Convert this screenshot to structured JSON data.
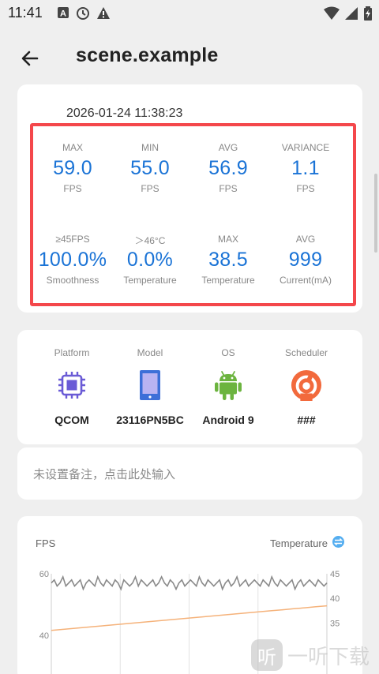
{
  "status_bar": {
    "time": "11:41",
    "left_icons": [
      "text-a-icon",
      "clock-icon",
      "warning-icon"
    ],
    "right_icons": [
      "wifi-icon",
      "cellular-icon",
      "battery-charging-icon"
    ]
  },
  "app_bar": {
    "title": "scene.example"
  },
  "summary": {
    "timestamp": "2026-01-24 11:38:23",
    "stats_row1": [
      {
        "label": "MAX",
        "value": "59.0",
        "unit": "FPS"
      },
      {
        "label": "MIN",
        "value": "55.0",
        "unit": "FPS"
      },
      {
        "label": "AVG",
        "value": "56.9",
        "unit": "FPS"
      },
      {
        "label": "VARIANCE",
        "value": "1.1",
        "unit": "FPS"
      }
    ],
    "stats_row2": [
      {
        "label": "≥45FPS",
        "value": "100.0%",
        "unit": "Smoothness"
      },
      {
        "label": "＞46°C",
        "value": "0.0%",
        "unit": "Temperature"
      },
      {
        "label": "MAX",
        "value": "38.5",
        "unit": "Temperature"
      },
      {
        "label": "AVG",
        "value": "999",
        "unit": "Current(mA)"
      }
    ],
    "highlight_color": "#f4474b",
    "value_color": "#1a73d6"
  },
  "device": {
    "items": [
      {
        "label": "Platform",
        "value": "QCOM",
        "icon": "chip-icon"
      },
      {
        "label": "Model",
        "value": "23116PN5BC",
        "icon": "phone-icon"
      },
      {
        "label": "OS",
        "value": "Android 9",
        "icon": "android-icon"
      },
      {
        "label": "Scheduler",
        "value": "###",
        "icon": "scheduler-icon"
      }
    ]
  },
  "note": {
    "placeholder": "未设置备注，点击此处输入"
  },
  "chart": {
    "fps_label": "FPS",
    "temp_label": "Temperature",
    "left_ticks": [
      "60",
      "40"
    ],
    "right_ticks": [
      "45",
      "40",
      "35"
    ]
  },
  "chart_data": {
    "type": "line",
    "title": "",
    "xlabel": "",
    "ylabel": "FPS",
    "ylim": [
      40,
      60
    ],
    "y2label": "Temperature",
    "y2lim": [
      32.5,
      45
    ],
    "grid": true,
    "series": [
      {
        "name": "FPS",
        "axis": "left",
        "color": "#8a8a8a",
        "values": [
          57,
          58,
          56,
          57,
          59,
          56,
          57,
          58,
          56,
          57,
          58,
          55,
          57,
          58,
          57,
          56,
          59,
          57,
          56,
          58,
          57,
          56,
          58,
          57,
          55,
          58,
          57,
          56,
          57,
          59,
          56,
          58,
          57,
          56,
          57,
          58,
          56,
          57,
          59,
          57,
          56,
          58,
          57,
          55,
          57,
          58,
          56,
          57,
          58,
          57,
          56,
          59,
          57,
          56,
          58,
          57,
          56,
          57,
          58,
          55,
          57,
          58,
          56,
          57,
          59,
          56,
          57,
          58,
          56,
          57,
          58,
          57,
          56,
          58,
          57,
          56,
          59,
          57,
          56,
          58,
          57,
          56,
          57,
          58,
          55,
          57,
          58,
          56,
          57,
          58,
          57,
          56,
          58,
          57,
          56,
          57
        ]
      },
      {
        "name": "Temperature",
        "axis": "right",
        "color": "#f5b27a",
        "values": [
          33.5,
          33.7,
          33.9,
          34.1,
          34.3,
          34.5,
          34.7,
          34.9,
          35.1,
          35.3,
          35.5,
          35.7,
          35.9,
          36.1,
          36.3,
          36.5,
          36.7,
          36.9,
          37.1,
          37.3,
          37.5,
          37.7,
          37.9,
          38.1,
          38.3,
          38.5
        ]
      }
    ]
  },
  "watermark": {
    "glyph": "听",
    "text": "一听下载"
  }
}
